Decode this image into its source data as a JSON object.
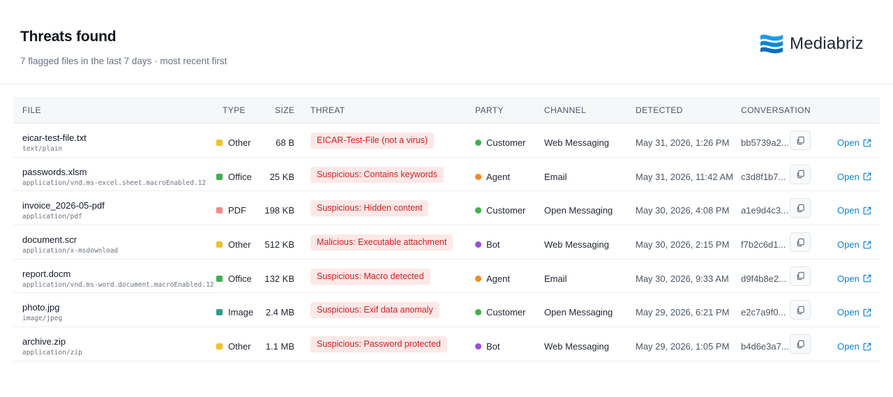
{
  "header": {
    "title": "Threats found",
    "subtitle": "7 flagged files in the last 7 days · most recent first",
    "brand": "Mediabriz"
  },
  "colors": {
    "accent_link": "#0b82d6",
    "threat_text": "#d21f1f",
    "threat_bg": "#fde8e8",
    "type_other": "#f5c02a",
    "type_office": "#3fb14e",
    "type_pdf": "#f28b8b",
    "type_image": "#2a9d8f",
    "party_customer": "#3fb14e",
    "party_agent": "#f58a1f",
    "party_bot": "#9b4fd6"
  },
  "table": {
    "columns": [
      "FILE",
      "TYPE",
      "SIZE",
      "THREAT",
      "PARTY",
      "CHANNEL",
      "DETECTED",
      "CONVERSATION"
    ],
    "open_label": "Open",
    "rows": [
      {
        "name": "eicar-test-file.txt",
        "mime": "text/plain",
        "type": "Other",
        "type_color": "#f5c02a",
        "size": "68 B",
        "threat": "EICAR-Test-File (not a virus)",
        "party": "Customer",
        "party_color": "#3fb14e",
        "channel": "Web Messaging",
        "detected": "May 31, 2026, 1:26 PM",
        "conversation": "bb5739a2..."
      },
      {
        "name": "passwords.xlsm",
        "mime": "application/vnd.ms-excel.sheet.macroEnabled.12",
        "type": "Office",
        "type_color": "#3fb14e",
        "size": "25 KB",
        "threat": "Suspicious: Contains keywords",
        "party": "Agent",
        "party_color": "#f58a1f",
        "channel": "Email",
        "detected": "May 31, 2026, 11:42 AM",
        "conversation": "c3d8f1b7..."
      },
      {
        "name": "invoice_2026-05-pdf",
        "mime": "application/pdf",
        "type": "PDF",
        "type_color": "#f28b8b",
        "size": "198 KB",
        "threat": "Suspicious: Hidden content",
        "party": "Customer",
        "party_color": "#3fb14e",
        "channel": "Open Messaging",
        "detected": "May 30, 2026, 4:08 PM",
        "conversation": "a1e9d4c3..."
      },
      {
        "name": "document.scr",
        "mime": "application/x-msdownload",
        "type": "Other",
        "type_color": "#f5c02a",
        "size": "512 KB",
        "threat": "Malicious: Executable attachment",
        "party": "Bot",
        "party_color": "#9b4fd6",
        "channel": "Web Messaging",
        "detected": "May 30, 2026, 2:15 PM",
        "conversation": "f7b2c6d1..."
      },
      {
        "name": "report.docm",
        "mime": "application/vnd.ms-word.document.macroEnabled.12",
        "type": "Office",
        "type_color": "#3fb14e",
        "size": "132 KB",
        "threat": "Suspicious: Macro detected",
        "party": "Agent",
        "party_color": "#f58a1f",
        "channel": "Email",
        "detected": "May 30, 2026, 9:33 AM",
        "conversation": "d9f4b8e2..."
      },
      {
        "name": "photo.jpg",
        "mime": "image/jpeg",
        "type": "Image",
        "type_color": "#2a9d8f",
        "size": "2.4 MB",
        "threat": "Suspicious: Exif data anomaly",
        "party": "Customer",
        "party_color": "#3fb14e",
        "channel": "Open Messaging",
        "detected": "May 29, 2026, 6:21 PM",
        "conversation": "e2c7a9f0..."
      },
      {
        "name": "archive.zip",
        "mime": "application/zip",
        "type": "Other",
        "type_color": "#f5c02a",
        "size": "1.1 MB",
        "threat": "Suspicious: Password protected",
        "party": "Bot",
        "party_color": "#9b4fd6",
        "channel": "Web Messaging",
        "detected": "May 29, 2026, 1:05 PM",
        "conversation": "b4d6e3a7..."
      }
    ]
  }
}
